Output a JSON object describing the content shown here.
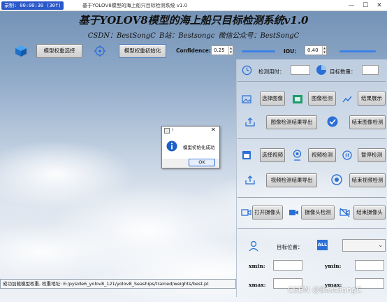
{
  "window": {
    "clock": "录制: 00:00:30 (30f)",
    "title": "基于YOLOV8模型的海上船只目标检测系统 v1.0",
    "minimize": "—",
    "maximize": "☐",
    "close": "✕"
  },
  "header": {
    "title": "基于YOLOV8模型的海上船只目标检测系统v1.0",
    "subtitle": "CSDN：BestSongC   B站：Bestsongc   微信公众号：BestSongC"
  },
  "toolbar": {
    "select_weights": "模型权重选择",
    "init_weights": "模型权重初始化",
    "confidence_label": "Confidence:",
    "confidence_value": "0.25",
    "iou_label": "IOU：",
    "iou_value": "0.40"
  },
  "stats": {
    "time_label": "检测用时：",
    "time_value": "",
    "count_label": "目标数量：",
    "count_value": ""
  },
  "image_section": {
    "select": "选择图像",
    "detect": "图像检测",
    "show": "结果展示",
    "export": "图像检测结果导出",
    "end": "结束图像检测"
  },
  "video_section": {
    "select": "选择视频",
    "detect": "视频检测",
    "pause": "暂停检测",
    "export": "视频检测结果导出",
    "end": "结束视频检测"
  },
  "camera_section": {
    "open": "打开摄像头",
    "detect": "摄像头检测",
    "end": "结束摄像头"
  },
  "target": {
    "position_label": "目标位置：",
    "all_badge": "ALL",
    "xmin": "xmin:",
    "ymin": "ymin:",
    "xmax": "xmax:",
    "ymax": "ymax:"
  },
  "status_bar": "成功加载模型权重, 权重地址: E:/pyside6_yolov8_121/yolov8_Seaships/trained/weights/best.pt",
  "dialog": {
    "title": "!",
    "message": "模型初始化成功",
    "ok": "OK"
  },
  "watermark": "CSDN @BestSongC",
  "colors": {
    "accent": "#2b6fd6",
    "slider": "#3c82e6"
  }
}
